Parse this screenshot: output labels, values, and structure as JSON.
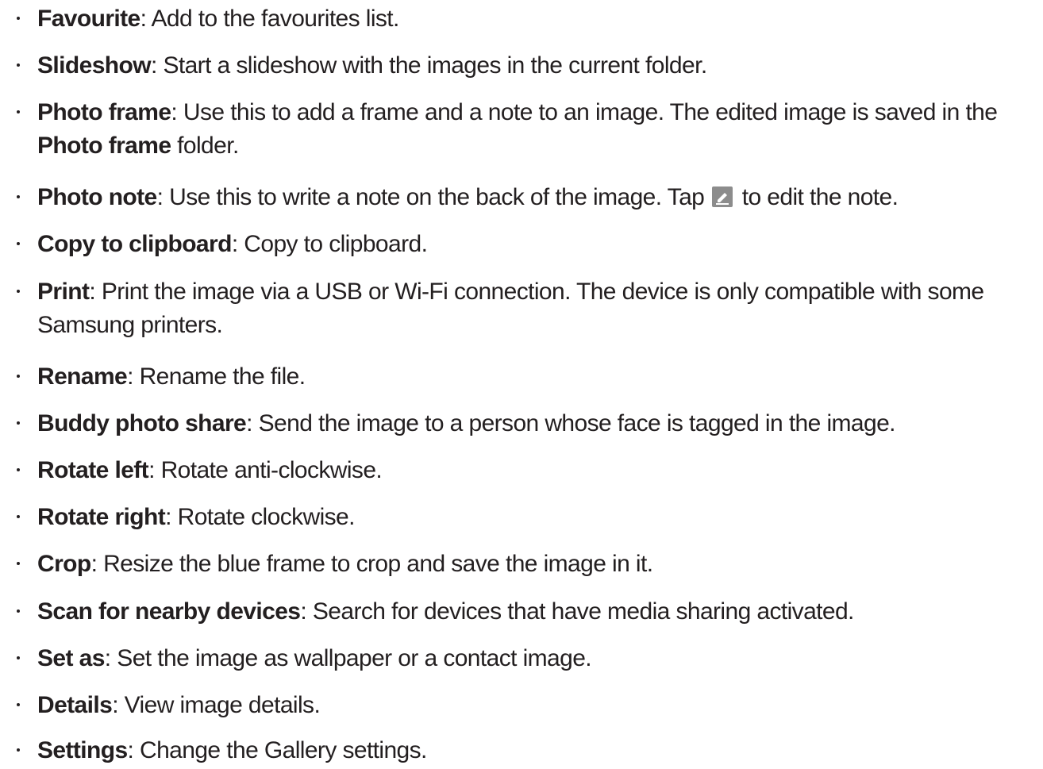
{
  "items": [
    {
      "term": "Favourite",
      "sep": ":",
      "desc": " Add to the favourites list."
    },
    {
      "term": "Slideshow",
      "sep": ":",
      "desc": " Start a slideshow with the images in the current folder."
    },
    {
      "term": "Photo frame",
      "sep": ":",
      "desc": " Use this to add a frame and a note to an image. The edited image is saved in the ",
      "inline_term": "Photo frame",
      "desc_end": " folder."
    },
    {
      "term": "Photo note",
      "sep": ":",
      "desc": " Use this to write a note on the back of the image. Tap ",
      "icon": "edit-pencil-icon",
      "desc_end": " to edit the note."
    },
    {
      "term": "Copy to clipboard",
      "sep": ":",
      "desc": " Copy to clipboard."
    },
    {
      "term": "Print",
      "sep": ":",
      "desc": " Print the image via a USB or Wi-Fi connection. The device is only compatible with some Samsung printers."
    },
    {
      "term": "Rename",
      "sep": ":",
      "desc": " Rename the file."
    },
    {
      "term": "Buddy photo share",
      "sep": ":",
      "desc": " Send the image to a person whose face is tagged in the image."
    },
    {
      "term": "Rotate left",
      "sep": ":",
      "desc": " Rotate anti-clockwise."
    },
    {
      "term": "Rotate right",
      "sep": ":",
      "desc": " Rotate clockwise."
    },
    {
      "term": "Crop",
      "sep": ":",
      "desc": " Resize the blue frame to crop and save the image in it."
    },
    {
      "term": "Scan for nearby devices",
      "sep": ":",
      "desc": " Search for devices that have media sharing activated."
    },
    {
      "term": "Set as",
      "sep": ":",
      "desc": " Set the image as wallpaper or a contact image."
    },
    {
      "term": "Details",
      "sep": ":",
      "desc": " View image details."
    },
    {
      "term": "Settings",
      "sep": ":",
      "desc": " Change the Gallery settings."
    }
  ],
  "colors": {
    "text": "#231f20",
    "icon_bg": "#8c8c8c",
    "icon_fg": "#ffffff"
  }
}
